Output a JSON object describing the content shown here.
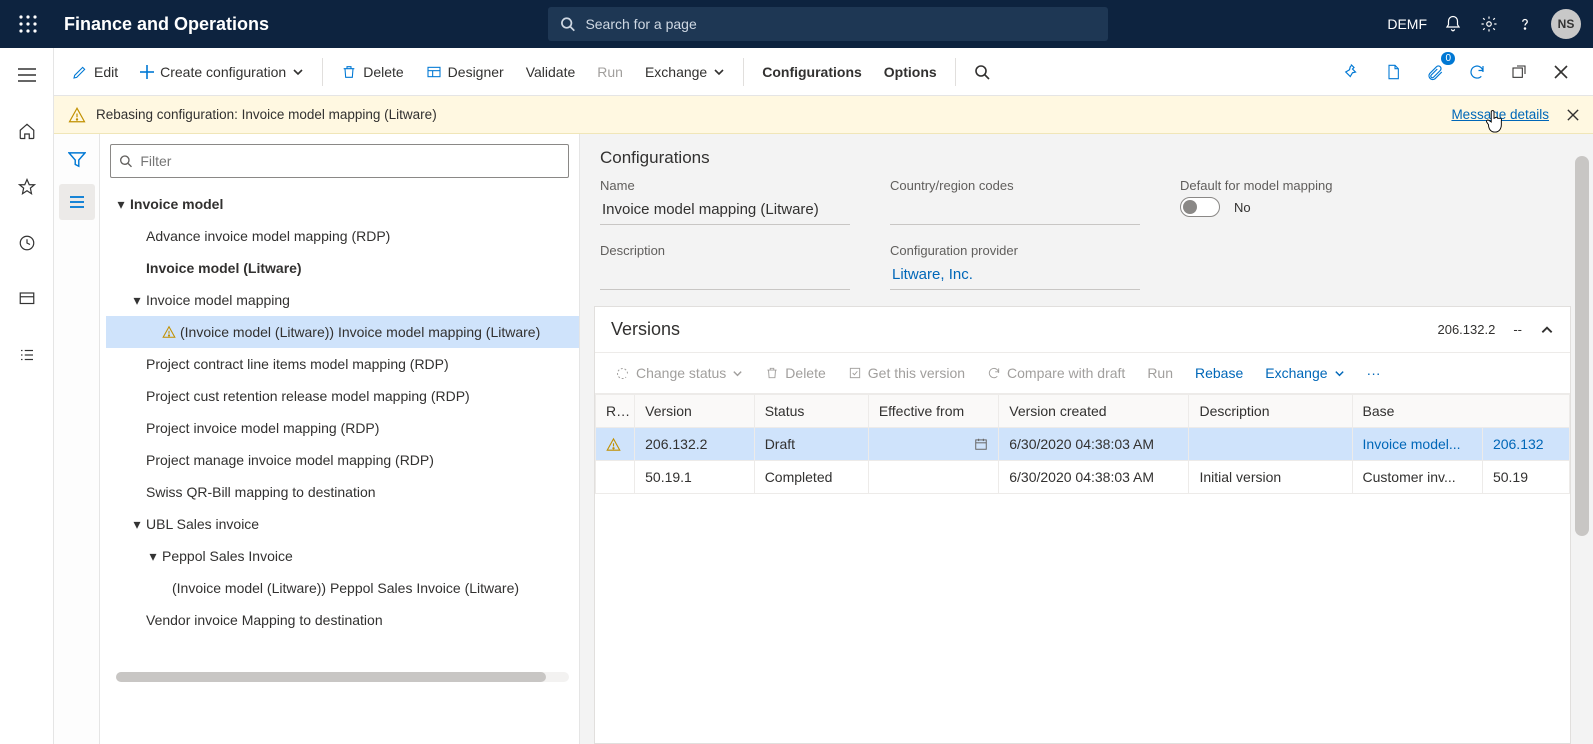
{
  "header": {
    "app_title": "Finance and Operations",
    "search_placeholder": "Search for a page",
    "company": "DEMF",
    "user_initials": "NS"
  },
  "actionbar": {
    "edit": "Edit",
    "create_config": "Create configuration",
    "delete": "Delete",
    "designer": "Designer",
    "validate": "Validate",
    "run": "Run",
    "exchange": "Exchange",
    "configurations": "Configurations",
    "options": "Options",
    "badge_count": "0"
  },
  "warning": {
    "text": "Rebasing configuration: Invoice model mapping (Litware)",
    "link": "Message details"
  },
  "filter": {
    "placeholder": "Filter"
  },
  "tree": {
    "root": "Invoice model",
    "n1": "Advance invoice model mapping (RDP)",
    "n2": "Invoice model (Litware)",
    "n3": "Invoice model mapping",
    "n3a": "(Invoice model (Litware)) Invoice model mapping (Litware)",
    "n4": "Project contract line items model mapping (RDP)",
    "n5": "Project cust retention release model mapping (RDP)",
    "n6": "Project invoice model mapping (RDP)",
    "n7": "Project manage invoice model mapping (RDP)",
    "n8": "Swiss QR-Bill mapping to destination",
    "n9": "UBL Sales invoice",
    "n9a": "Peppol Sales Invoice",
    "n9a1": "(Invoice model (Litware)) Peppol Sales Invoice (Litware)",
    "n10": "Vendor invoice Mapping to destination"
  },
  "details": {
    "section": "Configurations",
    "labels": {
      "name": "Name",
      "desc": "Description",
      "region": "Country/region codes",
      "provider": "Configuration provider",
      "default_mm": "Default for model mapping"
    },
    "values": {
      "name": "Invoice model mapping (Litware)",
      "provider": "Litware, Inc.",
      "default_mm_text": "No"
    }
  },
  "versions": {
    "title": "Versions",
    "head_version": "206.132.2",
    "head_sep": "--",
    "toolbar": {
      "change_status": "Change status",
      "delete": "Delete",
      "get": "Get this version",
      "compare": "Compare with draft",
      "run": "Run",
      "rebase": "Rebase",
      "exchange": "Exchange"
    },
    "columns": {
      "r": "R...",
      "version": "Version",
      "status": "Status",
      "effective": "Effective from",
      "created": "Version created",
      "desc": "Description",
      "base": "Base",
      "base2": ""
    },
    "rows": [
      {
        "warn": true,
        "version": "206.132.2",
        "status": "Draft",
        "effective": "",
        "created": "6/30/2020 04:38:03 AM",
        "desc": "",
        "base": "Invoice model...",
        "base_ver": "206.132"
      },
      {
        "warn": false,
        "version": "50.19.1",
        "status": "Completed",
        "effective": "",
        "created": "6/30/2020 04:38:03 AM",
        "desc": "Initial version",
        "base": "Customer inv...",
        "base_ver": "50.19"
      }
    ]
  }
}
